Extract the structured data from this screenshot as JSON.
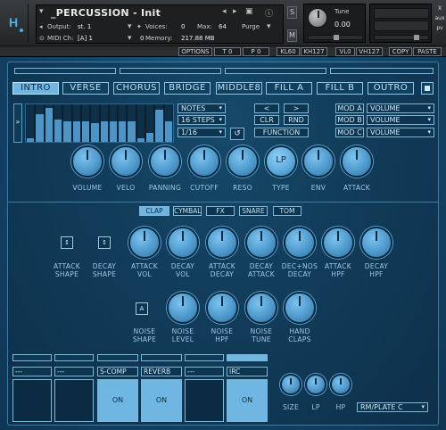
{
  "header": {
    "instrument_name": "_PERCUSSION - Init",
    "output_label": "Output:",
    "output_value": "st. 1",
    "voices_label": "Voices:",
    "voices_value": "0",
    "max_label": "Max:",
    "max_value": "64",
    "purge_label": "Purge",
    "midi_label": "MIDI Ch:",
    "midi_value": "[A] 1",
    "memory_label": "Memory:",
    "memory_value": "217.88 MB",
    "memory_count": "0",
    "solo_label": "S",
    "mute_label": "M",
    "tune_label": "Tune",
    "tune_value": "0.00",
    "side_labels": [
      "X",
      "aux",
      "pv"
    ],
    "pan_meter_l": "L",
    "pan_meter_r": "R"
  },
  "topbar": {
    "options": "OPTIONS",
    "t": "T 0",
    "p": "P 0",
    "kl": "KL60",
    "kh": "KH127",
    "vl": "VL0",
    "vh": "VH127",
    "copy": "COPY",
    "paste": "PASTE"
  },
  "tabs": [
    "INTRO",
    "VERSE",
    "CHORUS",
    "BRIDGE",
    "MIDDLE8",
    "FILL A",
    "FILL B",
    "OUTRO"
  ],
  "active_tab": "INTRO",
  "sequencer": {
    "arrow": "»",
    "notes": "NOTES",
    "steps": "16 STEPS",
    "rate": "1/16",
    "step_levels": [
      0.1,
      0.75,
      0.9,
      0.6,
      0.55,
      0.55,
      0.55,
      0.5,
      0.55,
      0.55,
      0.55,
      0.55,
      0.1,
      0.25,
      0.85,
      0.55
    ],
    "left_label": "<",
    "right_label": ">",
    "clr_label": "CLR",
    "rnd_label": "RND",
    "function_label": "FUNCTION",
    "reset_icon": "↺",
    "mods": [
      {
        "name": "MOD A",
        "target": "VOLUME"
      },
      {
        "name": "MOD B",
        "target": "VOLUME"
      },
      {
        "name": "MOD C",
        "target": "VOLUME"
      }
    ]
  },
  "main_knobs": [
    "VOLUME",
    "VELO",
    "PANNING",
    "CUTOFF",
    "RESO",
    "TYPE",
    "ENV",
    "ATTACK"
  ],
  "lp_label": "LP",
  "drum_tabs": [
    "CLAP",
    "CYMBAL",
    "FX",
    "SNARE",
    "TOM"
  ],
  "active_drum_tab": "CLAP",
  "clap_row1": [
    {
      "label": "ATTACK\nSHAPE",
      "kind": "button"
    },
    {
      "label": "DECAY\nSHAPE",
      "kind": "button"
    },
    {
      "label": "ATTACK\nVOL",
      "kind": "knob"
    },
    {
      "label": "DECAY\nVOL",
      "kind": "knob"
    },
    {
      "label": "ATTACK\nDECAY",
      "kind": "knob"
    },
    {
      "label": "DECAY\nATTACK",
      "kind": "knob"
    },
    {
      "label": "DEC+NOS\nDECAY",
      "kind": "knob"
    },
    {
      "label": "ATTACK\nHPF",
      "kind": "knob"
    },
    {
      "label": "DECAY\nHPF",
      "kind": "knob"
    }
  ],
  "clap_row2": [
    {
      "label": "NOISE\nSHAPE",
      "kind": "button"
    },
    {
      "label": "NOISE\nLEVEL",
      "kind": "knob"
    },
    {
      "label": "NOISE\nHPF",
      "kind": "knob"
    },
    {
      "label": "NOISE\nTUNE",
      "kind": "knob"
    },
    {
      "label": "HAND\nCLAPS",
      "kind": "knob"
    }
  ],
  "fx_slots": [
    {
      "name": "---",
      "on": false,
      "on_label": ""
    },
    {
      "name": "---",
      "on": false,
      "on_label": ""
    },
    {
      "name": "S-COMP",
      "on": true,
      "on_label": "ON"
    },
    {
      "name": "REVERB",
      "on": true,
      "on_label": "ON"
    },
    {
      "name": "---",
      "on": false,
      "on_label": ""
    },
    {
      "name": "IRC",
      "on": true,
      "on_label": "ON"
    }
  ],
  "fx_knobs": [
    "SIZE",
    "LP",
    "HP"
  ],
  "reverb_type": "RM/PLATE C",
  "colors": {
    "accent": "#6fb6e2",
    "panel": "#154a6d"
  }
}
